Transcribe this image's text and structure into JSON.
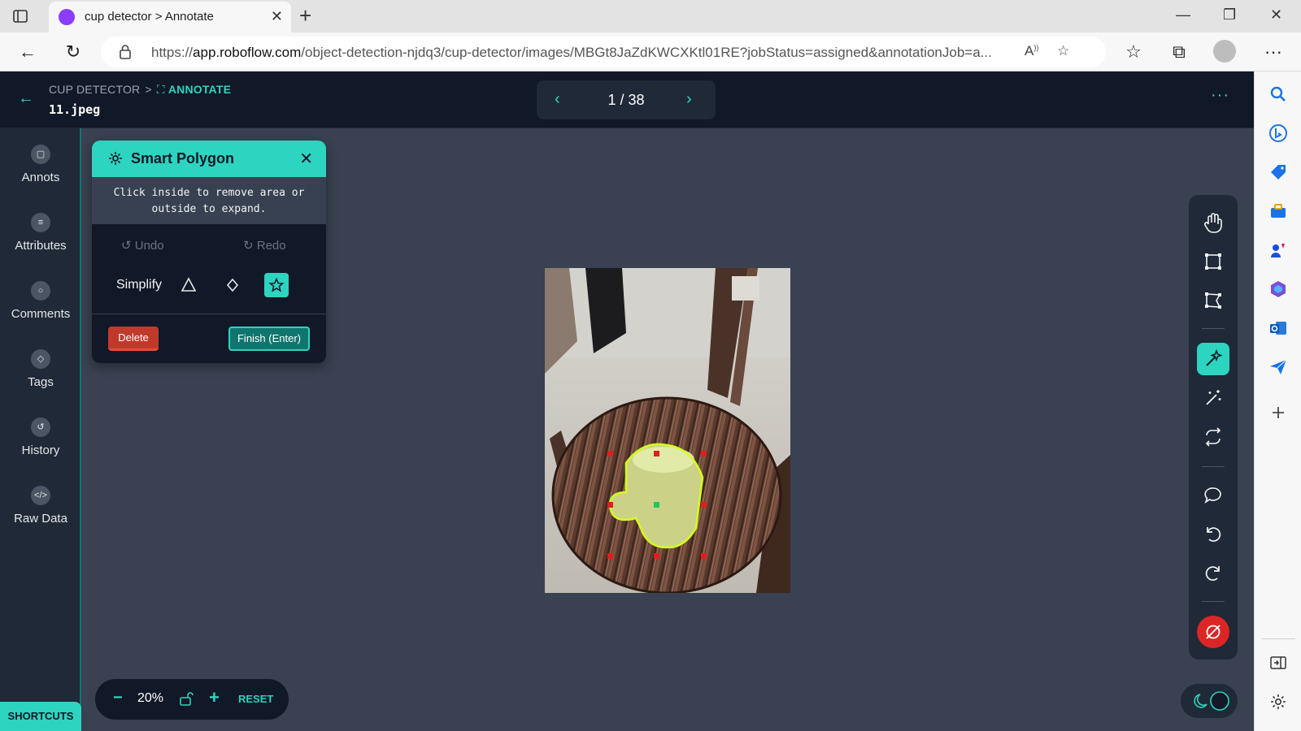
{
  "browser": {
    "tab_title": "cup detector > Annotate",
    "url_domain": "app.roboflow.com",
    "url_prefix": "https://",
    "url_path": "/object-detection-njdq3/cup-detector/images/MBGt8JaZdKWCXKtl01RE?jobStatus=assigned&annotationJob=a..."
  },
  "header": {
    "project": "CUP DETECTOR",
    "separator": ">",
    "section": "ANNOTATE",
    "filename": "11.jpeg",
    "pager": "1 / 38",
    "more": "···"
  },
  "left_rail": {
    "items": [
      {
        "label": "Annots",
        "icon": "annots-icon"
      },
      {
        "label": "Attributes",
        "icon": "list-icon"
      },
      {
        "label": "Comments",
        "icon": "comment-icon"
      },
      {
        "label": "Tags",
        "icon": "tag-icon"
      },
      {
        "label": "History",
        "icon": "history-icon"
      },
      {
        "label": "Raw Data",
        "icon": "code-icon"
      }
    ],
    "shortcuts": "SHORTCUTS"
  },
  "smart_polygon": {
    "title": "Smart Polygon",
    "hint": "Click inside to remove area or outside to expand.",
    "undo": "Undo",
    "redo": "Redo",
    "simplify": "Simplify",
    "delete": "Delete",
    "finish": "Finish (Enter)"
  },
  "zoom": {
    "minus": "−",
    "value": "20%",
    "plus": "+",
    "reset": "RESET"
  },
  "colors": {
    "accent": "#2dd4bf",
    "header_bg": "#111827",
    "canvas_bg": "#394152",
    "delete_red": "#c0392b",
    "polygon_stroke": "#d4ff1e"
  }
}
